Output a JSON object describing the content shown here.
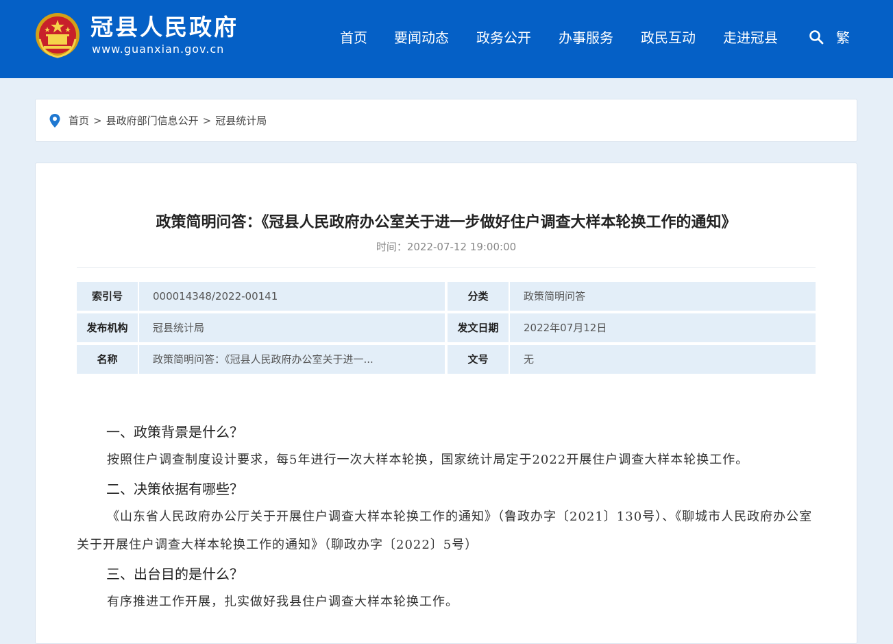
{
  "header": {
    "site_title": "冠县人民政府",
    "site_url": "www.guanxian.gov.cn",
    "emblem_icon": "national-emblem-icon",
    "nav": [
      {
        "label": "首页"
      },
      {
        "label": "要闻动态"
      },
      {
        "label": "政务公开"
      },
      {
        "label": "办事服务"
      },
      {
        "label": "政民互动"
      },
      {
        "label": "走进冠县"
      }
    ],
    "search_icon": "search-icon",
    "traditional_label": "繁",
    "colors": {
      "bar": "#0560c6",
      "text": "#ffffff"
    }
  },
  "breadcrumb": {
    "icon": "location-pin-icon",
    "items": [
      "首页",
      "县政府部门信息公开",
      "冠县统计局"
    ],
    "separator": ">"
  },
  "article": {
    "title": "政策简明问答：《冠县人民政府办公室关于进一步做好住户调查大样本轮换工作的通知》",
    "time_label": "时间：",
    "time_value": "2022-07-12 19:00:00",
    "meta": {
      "index_key": "索引号",
      "index_value": "000014348/2022-00141",
      "category_key": "分类",
      "category_value": "政策简明问答",
      "publisher_key": "发布机构",
      "publisher_value": "冠县统计局",
      "date_key": "发文日期",
      "date_value": "2022年07月12日",
      "name_key": "名称",
      "name_value": "政策简明问答：《冠县人民政府办公室关于进一...",
      "doc_no_key": "文号",
      "doc_no_value": "无"
    },
    "sections": [
      {
        "heading": "一、政策背景是什么？",
        "text": "按照住户调查制度设计要求，每5年进行一次大样本轮换，国家统计局定于2022开展住户调查大样本轮换工作。"
      },
      {
        "heading": "二、决策依据有哪些？",
        "text": "《山东省人民政府办公厅关于开展住户调查大样本轮换工作的通知》（鲁政办字〔2021〕130号）、《聊城市人民政府办公室关于开展住户调查大样本轮换工作的通知》（聊政办字〔2022〕5号）"
      },
      {
        "heading": "三、出台目的是什么？",
        "text": "有序推进工作开展，扎实做好我县住户调查大样本轮换工作。"
      }
    ]
  }
}
